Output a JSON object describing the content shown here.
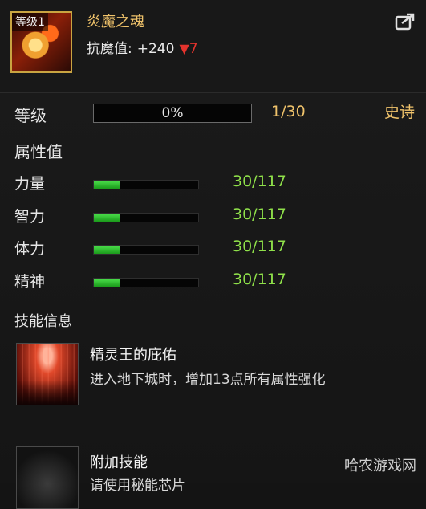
{
  "item": {
    "level_badge": "等级1",
    "name": "炎魔之魂",
    "stat_label": "抗魔值:",
    "stat_value": "+240",
    "stat_change": "7",
    "change_arrow": "▼"
  },
  "level": {
    "label": "等级",
    "progress_text": "0%",
    "progress": 0,
    "count": "1/30",
    "rarity": "史诗"
  },
  "attributes": {
    "title": "属性值",
    "items": [
      {
        "name": "力量",
        "value": "30/117",
        "fraction": 0.256
      },
      {
        "name": "智力",
        "value": "30/117",
        "fraction": 0.256
      },
      {
        "name": "体力",
        "value": "30/117",
        "fraction": 0.256
      },
      {
        "name": "精神",
        "value": "30/117",
        "fraction": 0.256
      }
    ]
  },
  "skills": {
    "title": "技能信息",
    "items": [
      {
        "name": "精灵王的庇佑",
        "desc": "进入地下城时，增加13点所有属性强化"
      },
      {
        "name": "附加技能",
        "desc": "请使用秘能芯片"
      }
    ]
  },
  "watermark": "哈农游戏网",
  "colors": {
    "accent_gold": "#f0c36b",
    "value_green": "#8fe04a",
    "decrease_red": "#e3332d"
  },
  "icons": {
    "export": "export-icon"
  }
}
